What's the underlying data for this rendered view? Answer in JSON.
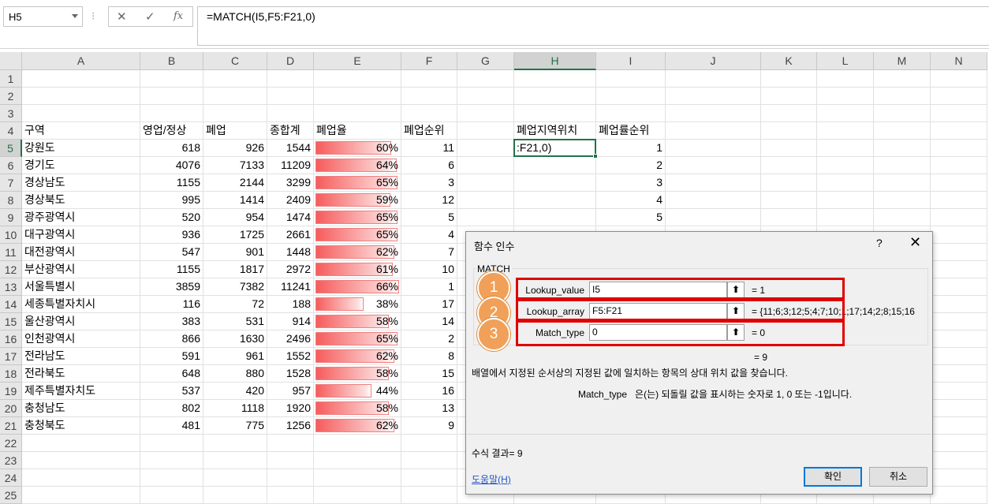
{
  "formula_bar": {
    "name_box": "H5",
    "separator": "⁝",
    "cancel_glyph": "✕",
    "enter_glyph": "✓",
    "fx_glyph": "fx",
    "formula": "=MATCH(I5,F5:F21,0)"
  },
  "columns": [
    "A",
    "B",
    "C",
    "D",
    "E",
    "F",
    "G",
    "H",
    "I",
    "J",
    "K",
    "L",
    "M",
    "N"
  ],
  "rows": [
    "1",
    "2",
    "3",
    "4",
    "5",
    "6",
    "7",
    "8",
    "9",
    "10",
    "11",
    "12",
    "13",
    "14",
    "15",
    "16",
    "17",
    "18",
    "19",
    "20",
    "21",
    "22",
    "23",
    "24",
    "25"
  ],
  "headers": {
    "A": "구역",
    "B": "영업/정상",
    "C": "폐업",
    "D": "종합계",
    "E": "폐업율",
    "F": "폐업순위",
    "H": "폐업지역위치",
    "I": "폐업률순위"
  },
  "table": [
    {
      "region": "강원도",
      "open": "618",
      "closed": "926",
      "total": "1544",
      "rate": "60%",
      "rate_value": 0.6,
      "rank": "11"
    },
    {
      "region": "경기도",
      "open": "4076",
      "closed": "7133",
      "total": "11209",
      "rate": "64%",
      "rate_value": 0.64,
      "rank": "6"
    },
    {
      "region": "경상남도",
      "open": "1155",
      "closed": "2144",
      "total": "3299",
      "rate": "65%",
      "rate_value": 0.65,
      "rank": "3"
    },
    {
      "region": "경상북도",
      "open": "995",
      "closed": "1414",
      "total": "2409",
      "rate": "59%",
      "rate_value": 0.59,
      "rank": "12"
    },
    {
      "region": "광주광역시",
      "open": "520",
      "closed": "954",
      "total": "1474",
      "rate": "65%",
      "rate_value": 0.65,
      "rank": "5"
    },
    {
      "region": "대구광역시",
      "open": "936",
      "closed": "1725",
      "total": "2661",
      "rate": "65%",
      "rate_value": 0.65,
      "rank": "4"
    },
    {
      "region": "대전광역시",
      "open": "547",
      "closed": "901",
      "total": "1448",
      "rate": "62%",
      "rate_value": 0.62,
      "rank": "7"
    },
    {
      "region": "부산광역시",
      "open": "1155",
      "closed": "1817",
      "total": "2972",
      "rate": "61%",
      "rate_value": 0.61,
      "rank": "10"
    },
    {
      "region": "서울특별시",
      "open": "3859",
      "closed": "7382",
      "total": "11241",
      "rate": "66%",
      "rate_value": 0.66,
      "rank": "1"
    },
    {
      "region": "세종특별자치시",
      "open": "116",
      "closed": "72",
      "total": "188",
      "rate": "38%",
      "rate_value": 0.38,
      "rank": "17"
    },
    {
      "region": "울산광역시",
      "open": "383",
      "closed": "531",
      "total": "914",
      "rate": "58%",
      "rate_value": 0.58,
      "rank": "14"
    },
    {
      "region": "인천광역시",
      "open": "866",
      "closed": "1630",
      "total": "2496",
      "rate": "65%",
      "rate_value": 0.65,
      "rank": "2"
    },
    {
      "region": "전라남도",
      "open": "591",
      "closed": "961",
      "total": "1552",
      "rate": "62%",
      "rate_value": 0.62,
      "rank": "8"
    },
    {
      "region": "전라북도",
      "open": "648",
      "closed": "880",
      "total": "1528",
      "rate": "58%",
      "rate_value": 0.58,
      "rank": "15"
    },
    {
      "region": "제주특별자치도",
      "open": "537",
      "closed": "420",
      "total": "957",
      "rate": "44%",
      "rate_value": 0.44,
      "rank": "16"
    },
    {
      "region": "충청남도",
      "open": "802",
      "closed": "1118",
      "total": "1920",
      "rate": "58%",
      "rate_value": 0.58,
      "rank": "13"
    },
    {
      "region": "충청북도",
      "open": "481",
      "closed": "775",
      "total": "1256",
      "rate": "62%",
      "rate_value": 0.62,
      "rank": "9"
    }
  ],
  "active_cell": {
    "address": "H5",
    "display": ":F21,0)"
  },
  "rank_column": [
    "1",
    "2",
    "3",
    "4",
    "5"
  ],
  "dialog": {
    "title": "함수 인수",
    "help": "?",
    "close": "✕",
    "function_name": "MATCH",
    "args": [
      {
        "num": "1",
        "label": "Lookup_value",
        "value": "I5",
        "result": "=   1"
      },
      {
        "num": "2",
        "label": "Lookup_array",
        "value": "F5:F21",
        "result": "=   {11;6;3;12;5;4;7;10;1;17;14;2;8;15;16"
      },
      {
        "num": "3",
        "label": "Match_type",
        "value": "0",
        "result": "=   0"
      }
    ],
    "ref_button_glyph": "⬆",
    "total": "=   9",
    "description": "배열에서 지정된 순서상의 지정된 값에 일치하는 항목의 상대 위치 값을 찾습니다.",
    "arg_name": "Match_type",
    "arg_description": "은(는) 되돌릴 값을 표시하는 숫자로 1, 0 또는 -1입니다.",
    "result_label": "수식 결과=   9",
    "help_link": "도움말(H)",
    "ok": "확인",
    "cancel": "취소"
  }
}
